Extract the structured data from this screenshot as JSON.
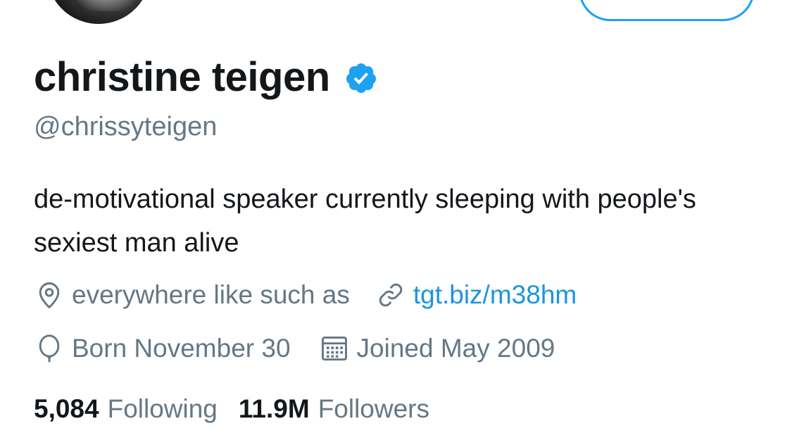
{
  "profile": {
    "display_name": "christine teigen",
    "handle": "@chrissyteigen",
    "verified": true,
    "bio": "de-motivational speaker currently sleeping with people's sexiest man alive",
    "location": "everywhere like such as",
    "website": "tgt.biz/m38hm",
    "birthday": "Born November 30",
    "joined": "Joined May 2009"
  },
  "stats": {
    "following_count": "5,084",
    "following_label": "Following",
    "followers_count": "11.9M",
    "followers_label": "Followers"
  },
  "icons": {
    "verified": "verified-badge-icon",
    "location": "location-pin-icon",
    "link": "link-icon",
    "birthday": "balloon-icon",
    "joined": "calendar-icon"
  },
  "colors": {
    "accent": "#1da1f2",
    "link": "#1b95e0",
    "secondary_text": "#657786",
    "primary_text": "#14171a"
  }
}
